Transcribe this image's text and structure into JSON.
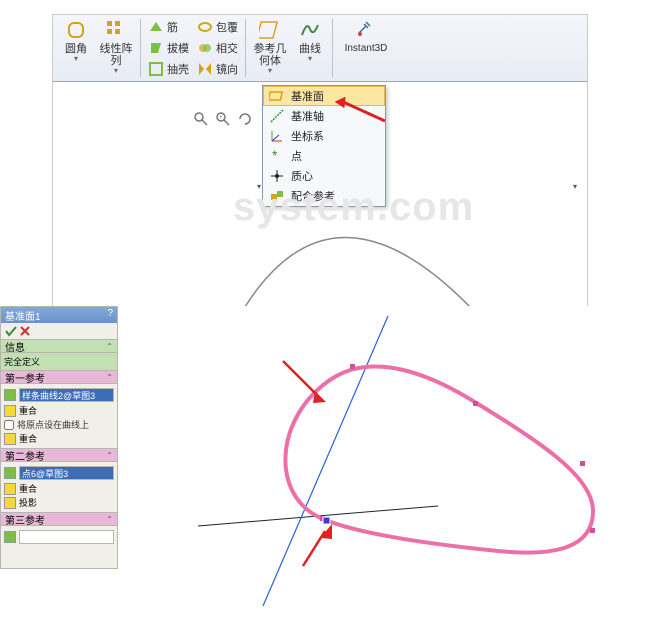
{
  "ribbon": {
    "fillet": "圆角",
    "linear_pattern": "线性阵\n列",
    "rib": "筋",
    "draft": "拔模",
    "shell": "抽壳",
    "wrap": "包覆",
    "intersect": "相交",
    "mirror": "镜向",
    "ref_geom": "参考几\n何体",
    "curves": "曲线",
    "instant3d": "Instant3D"
  },
  "dropdown": {
    "datum_plane": "基准面",
    "datum_axis": "基准轴",
    "coord_sys": "坐标系",
    "point": "点",
    "centroid": "质心",
    "mate_ref": "配合参考"
  },
  "watermark": "system.com",
  "pm": {
    "title": "基准面1",
    "help": "?",
    "msg_head": "信息",
    "msg_body": "完全定义",
    "ref1_head": "第一参考",
    "ref1_value": "样条曲线2@草图3",
    "tangent": "重合",
    "origin_on_curve": "将原点设在曲线上",
    "coincident": "重合",
    "ref2_head": "第二参考",
    "ref2_value": "点6@草图3",
    "coincident2": "重合",
    "projection": "投影",
    "ref3_head": "第三参考"
  }
}
